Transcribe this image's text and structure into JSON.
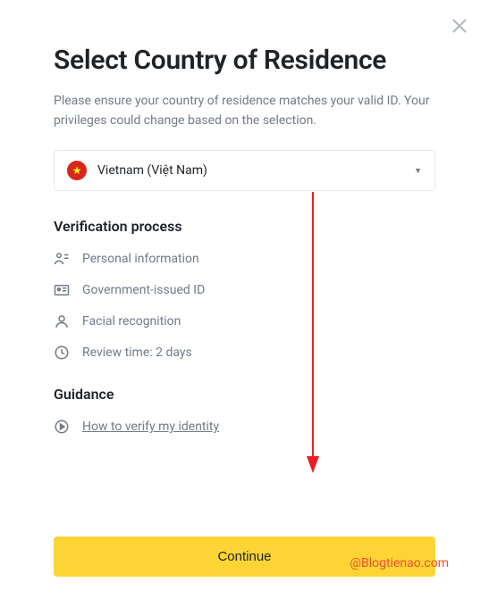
{
  "modal": {
    "title": "Select Country of Residence",
    "subtitle": "Please ensure your country of residence matches your valid ID. Your privileges could change based on the selection.",
    "country": {
      "name": "Vietnam (Việt Nam)"
    },
    "verification": {
      "heading": "Verification process",
      "items": [
        {
          "label": "Personal information"
        },
        {
          "label": "Government-issued ID"
        },
        {
          "label": "Facial recognition"
        },
        {
          "label": "Review time: 2 days"
        }
      ]
    },
    "guidance": {
      "heading": "Guidance",
      "link_text": "How to verify my identity"
    },
    "continue_label": "Continue"
  },
  "watermark": "@Blogtienao.com"
}
